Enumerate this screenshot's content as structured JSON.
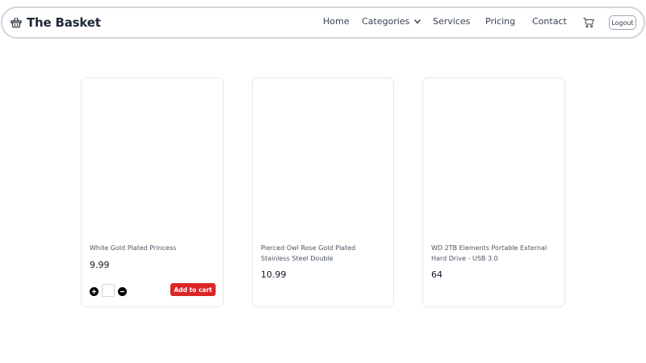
{
  "navbar": {
    "brand_icon": "basket-icon",
    "brand_name": "The Basket",
    "links": {
      "home": "Home",
      "categories": "Categories",
      "services": "Services",
      "pricing": "Pricing",
      "contact": "Contact"
    },
    "cart_icon": "cart-icon",
    "logout_label": "Logout"
  },
  "products": [
    {
      "title": "White Gold Plated Princess",
      "price": "9.99",
      "quantity": "",
      "add_to_cart_label": "Add to cart"
    },
    {
      "title": "Pierced Owl Rose Gold Plated Stainless Steel Double",
      "price": "10.99"
    },
    {
      "title": "WD 2TB Elements Portable External Hard Drive - USB 3.0",
      "price": "64"
    }
  ],
  "colors": {
    "accent": "#dc2626",
    "border": "#e5e7eb",
    "navbar_border": "#d1d5db"
  }
}
